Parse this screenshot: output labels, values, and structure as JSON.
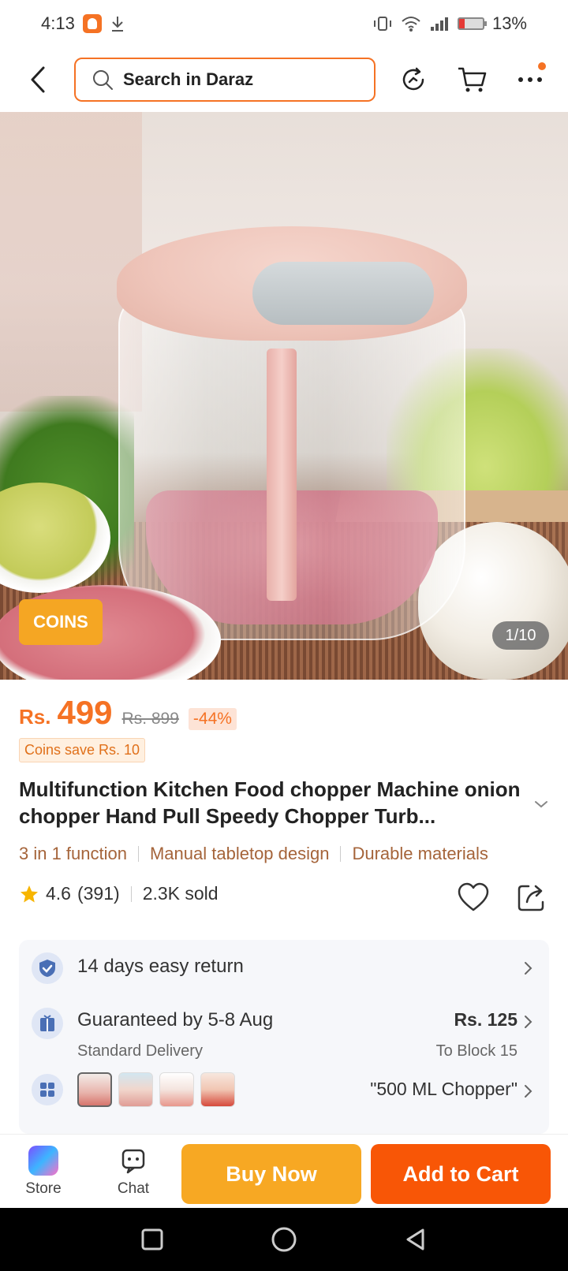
{
  "status_bar": {
    "time": "4:13",
    "battery": "13%",
    "battery_level": 0.13
  },
  "header": {
    "search_placeholder": "Search in Daraz",
    "icons": [
      "back-arrow-icon",
      "search-icon",
      "history-icon",
      "cart-icon",
      "more-icon"
    ]
  },
  "gallery": {
    "coins_badge": "COINS",
    "counter": "1/10"
  },
  "price": {
    "currency": "Rs.",
    "current": "499",
    "original": "Rs. 899",
    "discount": "-44%",
    "coins_save": "Coins save Rs. 10"
  },
  "product": {
    "title": "Multifunction Kitchen Food chopper Machine onion chopper Hand Pull Speedy Chopper Turb...",
    "features": [
      "3 in 1 function",
      "Manual tabletop design",
      "Durable materials"
    ],
    "rating": "4.6",
    "reviews": "(391)",
    "sold": "2.3K sold"
  },
  "services": {
    "return": "14 days easy return",
    "delivery_title": "Guaranteed by 5-8 Aug",
    "delivery_sub": "Standard Delivery",
    "delivery_fee": "Rs. 125",
    "delivery_to": "To Block 15",
    "variant": "\"500 ML Chopper\""
  },
  "actions": {
    "store": "Store",
    "chat": "Chat",
    "buy_now": "Buy Now",
    "add_to_cart": "Add to Cart"
  },
  "colors": {
    "accent": "#f57224",
    "buy_now": "#f7a823",
    "add_to_cart": "#f85606"
  }
}
